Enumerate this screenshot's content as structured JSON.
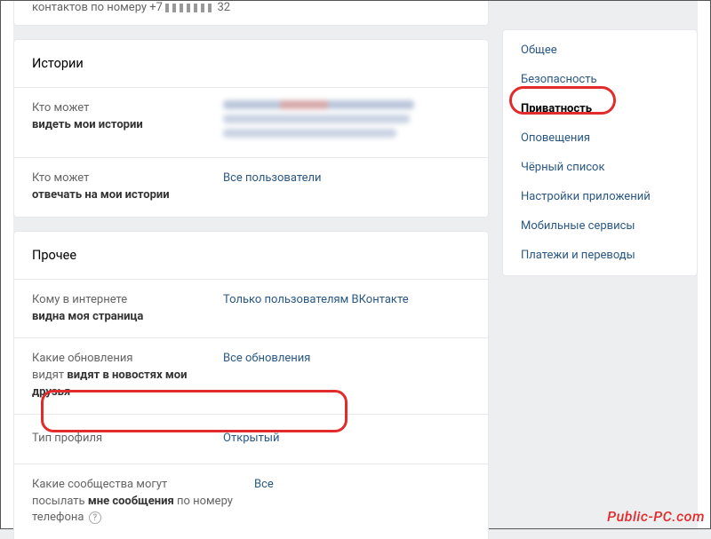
{
  "top_partial": {
    "prefix": "контактов по номеру +7",
    "suffix": "32"
  },
  "stories": {
    "title": "Истории",
    "rows": [
      {
        "label_muted": "Кто может",
        "label_bold": "видеть мои истории",
        "value": null
      },
      {
        "label_muted": "Кто может",
        "label_bold": "отвечать на мои истории",
        "value": "Все пользователи"
      }
    ]
  },
  "other": {
    "title": "Прочее",
    "rows": [
      {
        "label_muted": "Кому в интернете",
        "label_bold": "видна моя страница",
        "value": "Только пользователям ВКонтакте"
      },
      {
        "label_muted": "Какие обновления",
        "label_bold": "видят в новостях мои друзья",
        "value": "Все обновления"
      },
      {
        "label_plain": "Тип профиля",
        "value": "Открытый"
      },
      {
        "label_muted": "Какие сообщества могут",
        "label_bold_inline": "посылать мне сообщения по номеру телефона",
        "value": "Все"
      }
    ]
  },
  "sidebar": {
    "items": [
      {
        "label": "Общее"
      },
      {
        "label": "Безопасность"
      },
      {
        "label": "Приватность",
        "active": true
      },
      {
        "label": "Оповещения"
      },
      {
        "label": "Чёрный список"
      },
      {
        "label": "Настройки приложений"
      },
      {
        "label": "Мобильные сервисы"
      },
      {
        "label": "Платежи и переводы"
      }
    ]
  },
  "watermark": "Public-PC.com"
}
